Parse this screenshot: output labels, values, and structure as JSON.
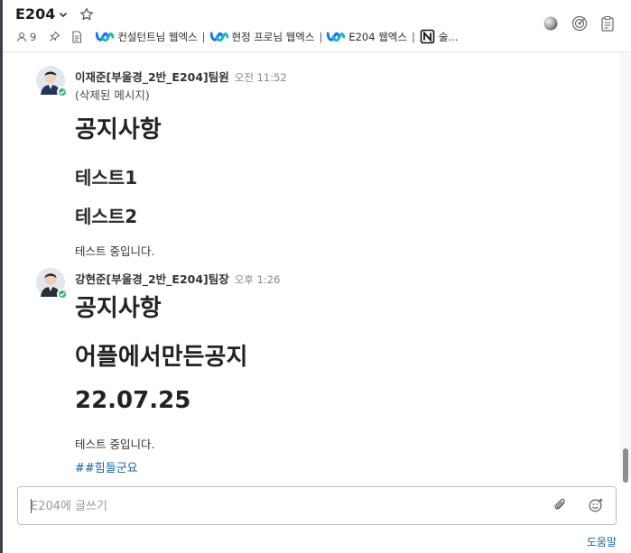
{
  "header": {
    "channel_title": "E204",
    "member_count": "9",
    "bookmarks": [
      {
        "label": "컨설턴트님 웹엑스",
        "icon": "webex-icon"
      },
      {
        "label": "현정 프로님 웹엑스",
        "icon": "webex-icon"
      },
      {
        "label": "E204 웹엑스",
        "icon": "webex-icon"
      },
      {
        "label": "술...",
        "icon": "notion-icon"
      }
    ],
    "separator": "|"
  },
  "messages": [
    {
      "author": "이재준[부울경_2반_E204]팀원",
      "time": "오전 11:52",
      "deleted": "(삭제된 메시지)",
      "h1": "공지사항",
      "h2a": "테스트1",
      "h2b": "테스트2",
      "body": "테스트 중입니다."
    },
    {
      "author": "강현준[부울경_2반_E204]팀장",
      "time": "오후 1:26",
      "h1a": "공지사항",
      "h1b": "어플에서만든공지",
      "h1c": "22.07.25",
      "body": "테스트 중입니다.",
      "hashtag": "##힘들군요"
    }
  ],
  "composer": {
    "placeholder": "E204에 글쓰기"
  },
  "help_link": "도움말",
  "colors": {
    "accent": "#1264a3",
    "online_badge": "#2eb67d",
    "left_edge": "#3a3f4b"
  }
}
